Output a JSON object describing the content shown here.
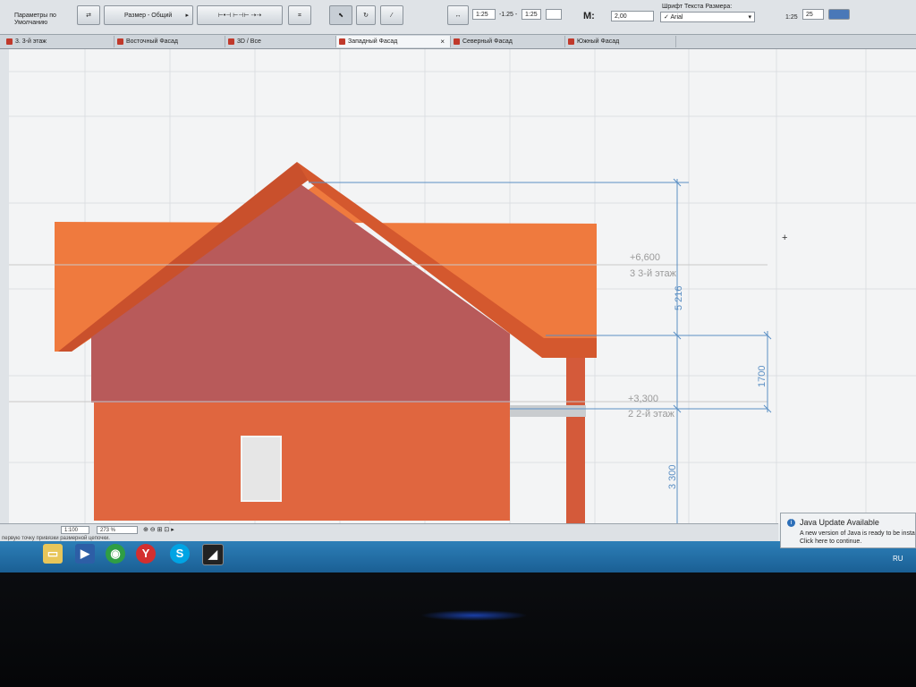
{
  "toolbar": {
    "params_line1": "Параметры по",
    "params_line2": "Умолчанию",
    "dim_type": "Размер - Общий",
    "scale_left": "1:25",
    "scale_right": "1:25",
    "scale_mid": "-1.25 -",
    "m_label": "M:",
    "m_value": "2,00",
    "font_label": "Шрифт Текста Размера:",
    "font_value": "Arial",
    "font_check": "✓",
    "size_label": "1:25",
    "size_value": "25"
  },
  "tabs": [
    {
      "label": "3. 3-й этаж"
    },
    {
      "label": "Восточный Фасад"
    },
    {
      "label": "3D / Все"
    },
    {
      "label": "Западный Фасад",
      "close": "×"
    },
    {
      "label": "Северный Фасад"
    },
    {
      "label": "Южный Фасад"
    }
  ],
  "drawing": {
    "level1_elev": "+6,600",
    "level1_name": "3 3-й этаж",
    "level2_elev": "+3,300",
    "level2_name": "2 2-й этаж",
    "dim_5216": "5 216",
    "dim_1700": "1700",
    "dim_3300": "3 300",
    "crosshair": "+"
  },
  "statusbar": {
    "scale": "1:100",
    "zoom": "273 %",
    "hint": "первую точку привязки размерной цепочки."
  },
  "notification": {
    "title": "Java Update Available",
    "line1": "A new version of Java is ready to be insta",
    "line2": "Click here to continue."
  },
  "taskbar": {
    "lang": "RU",
    "yandex_letter": "Y",
    "skype_letter": "S"
  },
  "colors": {
    "roof": "#ef7a3e",
    "roof_dark": "#c9502c",
    "wall_upper": "#b85a5a",
    "wall_lower": "#e0663f",
    "dim_line": "#5b8fc4"
  }
}
